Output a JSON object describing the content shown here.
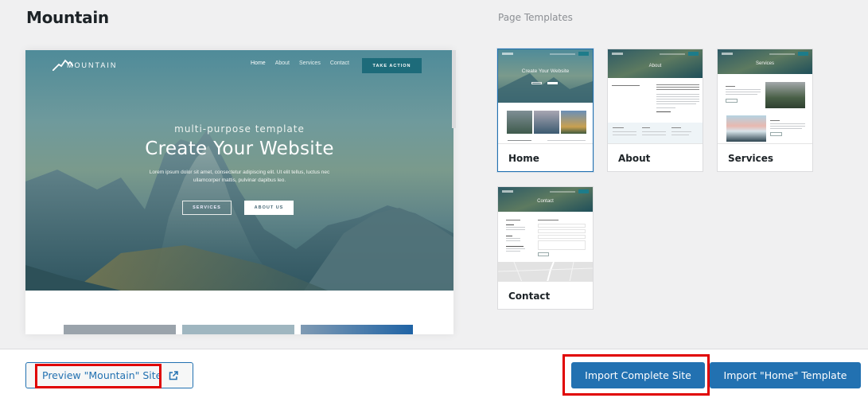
{
  "header": {
    "title": "Mountain"
  },
  "preview": {
    "logo_text": "MOUNTAIN",
    "nav": [
      "Home",
      "About",
      "Services",
      "Contact"
    ],
    "cta": "TAKE ACTION",
    "subtitle": "multi-purpose template",
    "title": "Create Your Website",
    "body": "Lorem ipsum dolor sit amet, consectetur adipiscing elit. Ut elit tellus, luctus nec ullamcorper mattis, pulvinar dapibus leo.",
    "buttons": [
      "SERVICES",
      "ABOUT US"
    ]
  },
  "templates": {
    "label": "Page Templates",
    "items": [
      {
        "name": "Home",
        "selected": true,
        "hero_title": "Create Your Website"
      },
      {
        "name": "About",
        "selected": false,
        "hero_title": "About"
      },
      {
        "name": "Services",
        "selected": false,
        "hero_title": "Services"
      },
      {
        "name": "Contact",
        "selected": false,
        "hero_title": "Contact"
      }
    ]
  },
  "footer": {
    "preview_label": "Preview \"Mountain\" Site",
    "import_site_label": "Import Complete Site",
    "import_template_label": "Import \"Home\" Template"
  },
  "colors": {
    "accent": "#2271b1",
    "highlight": "#e00000",
    "background": "#f0f0f1"
  }
}
